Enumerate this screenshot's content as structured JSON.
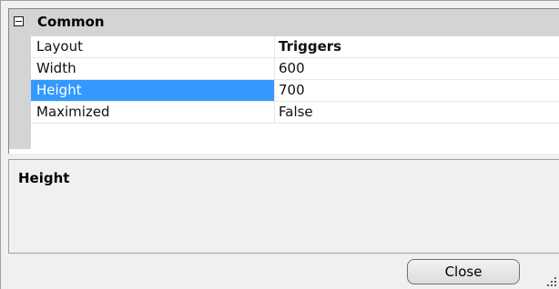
{
  "property_grid": {
    "category": {
      "label": "Common",
      "expander_icon": "collapse-box-icon"
    },
    "properties": [
      {
        "name": "Layout",
        "value": "Triggers",
        "value_bold": true,
        "selected": false
      },
      {
        "name": "Width",
        "value": "600",
        "value_bold": false,
        "selected": false
      },
      {
        "name": "Height",
        "value": "700",
        "value_bold": false,
        "selected": true
      },
      {
        "name": "Maximized",
        "value": "False",
        "value_bold": false,
        "selected": false
      }
    ]
  },
  "description": {
    "title": "Height",
    "text": ""
  },
  "footer": {
    "close_label": "Close",
    "grip_icon": "resize-grip-icon"
  },
  "colors": {
    "selection": "#3399ff",
    "category_background": "#d4d4d4",
    "window_background": "#f0f0f0"
  }
}
